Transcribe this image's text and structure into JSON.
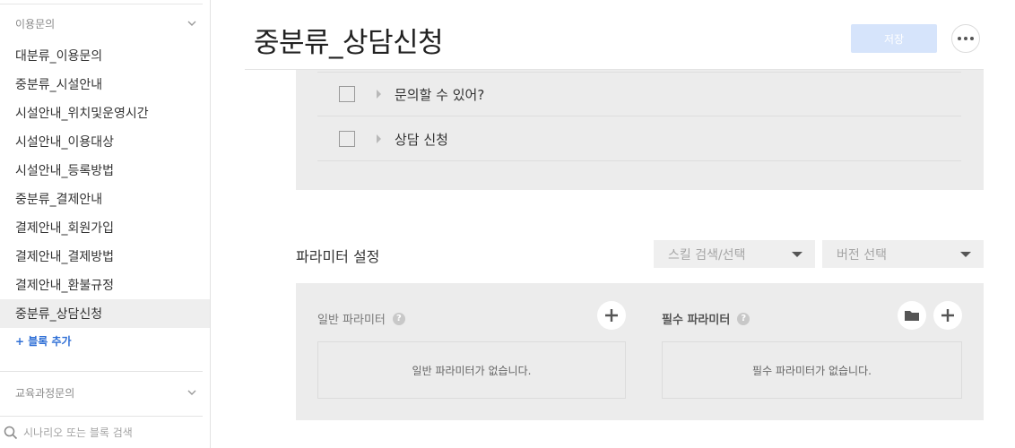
{
  "sidebar": {
    "group1_label": "이용문의",
    "items": [
      {
        "label": "대분류_이용문의"
      },
      {
        "label": "중분류_시설안내"
      },
      {
        "label": "시설안내_위치및운영시간"
      },
      {
        "label": "시설안내_이용대상"
      },
      {
        "label": "시설안내_등록방법"
      },
      {
        "label": "중분류_결제안내"
      },
      {
        "label": "결제안내_회원가입"
      },
      {
        "label": "결제안내_결제방법"
      },
      {
        "label": "결제안내_환불규정"
      },
      {
        "label": "중분류_상담신청"
      }
    ],
    "active_item": "중분류_상담신청",
    "add_block_label": "+ 블록 추가",
    "group2_label": "교육과정문의",
    "search_placeholder": "시나리오 또는 블록 검색"
  },
  "header": {
    "title": "중분류_상담신청",
    "save_label": "저장"
  },
  "utterances": [
    {
      "text": "문의할 수 있어?"
    },
    {
      "text": "상담 신청"
    }
  ],
  "parameters": {
    "title": "파라미터 설정",
    "skill_dropdown": "스킬 검색/선택",
    "version_dropdown": "버전 선택",
    "general": {
      "title": "일반 파라미터",
      "empty_text": "일반 파라미터가 없습니다."
    },
    "required": {
      "title": "필수 파라미터",
      "empty_text": "필수 파라미터가 없습니다."
    }
  },
  "colors": {
    "accent": "#2f6fd6",
    "save_disabled": "#d6e4fb",
    "panel_bg": "#ececec"
  }
}
